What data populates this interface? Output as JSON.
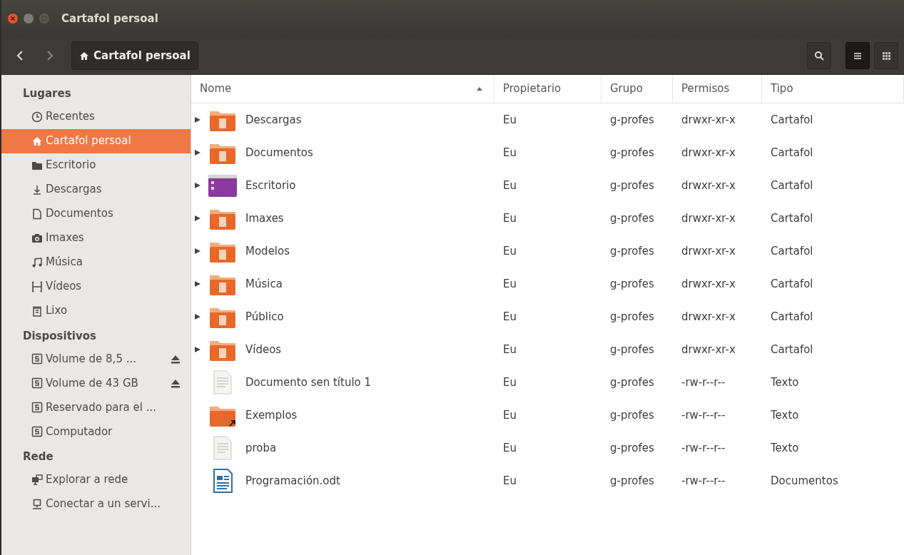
{
  "window": {
    "title": "Cartafol persoal"
  },
  "toolbar": {
    "path": "Cartafol persoal",
    "view_list_selected": true
  },
  "sidebar": [
    {
      "heading": "Lugares",
      "items": [
        {
          "label": "Recentes",
          "kind": "clock",
          "selected": false
        },
        {
          "label": "Cartafol persoal",
          "kind": "home",
          "selected": true
        },
        {
          "label": "Escritorio",
          "kind": "folder",
          "selected": false
        },
        {
          "label": "Descargas",
          "kind": "download",
          "selected": false
        },
        {
          "label": "Documentos",
          "kind": "document",
          "selected": false
        },
        {
          "label": "Imaxes",
          "kind": "camera",
          "selected": false
        },
        {
          "label": "Música",
          "kind": "music",
          "selected": false
        },
        {
          "label": "Vídeos",
          "kind": "film",
          "selected": false
        },
        {
          "label": "Lixo",
          "kind": "trash",
          "selected": false
        }
      ]
    },
    {
      "heading": "Dispositivos",
      "items": [
        {
          "label": "Volume de 8,5 ...",
          "kind": "drive",
          "selected": false,
          "eject": true
        },
        {
          "label": "Volume de 43 GB",
          "kind": "drive",
          "selected": false,
          "eject": true
        },
        {
          "label": "Reservado para el ...",
          "kind": "drive",
          "selected": false
        },
        {
          "label": "Computador",
          "kind": "drive",
          "selected": false
        }
      ]
    },
    {
      "heading": "Rede",
      "items": [
        {
          "label": "Explorar a rede",
          "kind": "network",
          "selected": false
        },
        {
          "label": "Conectar a un servi...",
          "kind": "server",
          "selected": false
        }
      ]
    }
  ],
  "table": {
    "columns": [
      "Nome",
      "Propietario",
      "Grupo",
      "Permisos",
      "Tipo"
    ],
    "rows": [
      {
        "kind": "folder",
        "expandable": true,
        "cells": [
          "Descargas",
          "Eu",
          "g-profes",
          "drwxr-xr-x",
          "Cartafol"
        ]
      },
      {
        "kind": "folder",
        "expandable": true,
        "cells": [
          "Documentos",
          "Eu",
          "g-profes",
          "drwxr-xr-x",
          "Cartafol"
        ]
      },
      {
        "kind": "desktop",
        "expandable": true,
        "cells": [
          "Escritorio",
          "Eu",
          "g-profes",
          "drwxr-xr-x",
          "Cartafol"
        ]
      },
      {
        "kind": "folder",
        "expandable": true,
        "cells": [
          "Imaxes",
          "Eu",
          "g-profes",
          "drwxr-xr-x",
          "Cartafol"
        ]
      },
      {
        "kind": "folder",
        "expandable": true,
        "cells": [
          "Modelos",
          "Eu",
          "g-profes",
          "drwxr-xr-x",
          "Cartafol"
        ]
      },
      {
        "kind": "folder",
        "expandable": true,
        "cells": [
          "Música",
          "Eu",
          "g-profes",
          "drwxr-xr-x",
          "Cartafol"
        ]
      },
      {
        "kind": "folder",
        "expandable": true,
        "cells": [
          "Público",
          "Eu",
          "g-profes",
          "drwxr-xr-x",
          "Cartafol"
        ]
      },
      {
        "kind": "folder",
        "expandable": true,
        "cells": [
          "Vídeos",
          "Eu",
          "g-profes",
          "drwxr-xr-x",
          "Cartafol"
        ]
      },
      {
        "kind": "text",
        "expandable": false,
        "cells": [
          "Documento sen título 1",
          "Eu",
          "g-profes",
          "-rw-r--r--",
          "Texto"
        ]
      },
      {
        "kind": "link",
        "expandable": false,
        "cells": [
          "Exemplos",
          "Eu",
          "g-profes",
          "-rw-r--r--",
          "Texto"
        ]
      },
      {
        "kind": "text",
        "expandable": false,
        "cells": [
          "proba",
          "Eu",
          "g-profes",
          "-rw-r--r--",
          "Texto"
        ]
      },
      {
        "kind": "odt",
        "expandable": false,
        "cells": [
          "Programación.odt",
          "Eu",
          "g-profes",
          "-rw-r--r--",
          "Documentos"
        ]
      }
    ]
  }
}
